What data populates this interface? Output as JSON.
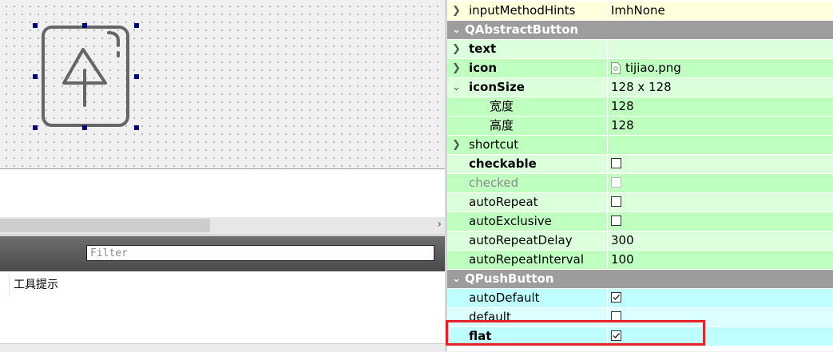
{
  "filter": {
    "placeholder": "Filter"
  },
  "action_list": {
    "items": [
      "工具提示"
    ]
  },
  "colors": {
    "highlight": "#e8202a",
    "category": "#9d9d9d",
    "green_light": "#dcffdc",
    "green_dark": "#bfffbf",
    "cyan_light": "#dcffff",
    "cyan_dark": "#bfffff",
    "yellow": "#ffffdc"
  },
  "properties": {
    "input_method_hints": {
      "name": "inputMethodHints",
      "value": "ImhNone"
    },
    "cat_abstract_button": "QAbstractButton",
    "text": {
      "name": "text",
      "value": ""
    },
    "icon": {
      "name": "icon",
      "value": "tijiao.png",
      "icon": "image-file-icon"
    },
    "icon_size": {
      "name": "iconSize",
      "value": "128 x 128"
    },
    "width": {
      "name": "宽度",
      "value": "128"
    },
    "height": {
      "name": "高度",
      "value": "128"
    },
    "shortcut": {
      "name": "shortcut",
      "value": ""
    },
    "checkable": {
      "name": "checkable",
      "checked": false
    },
    "checked": {
      "name": "checked",
      "checked": false
    },
    "auto_repeat": {
      "name": "autoRepeat",
      "checked": false
    },
    "auto_exclusive": {
      "name": "autoExclusive",
      "checked": false
    },
    "auto_repeat_delay": {
      "name": "autoRepeatDelay",
      "value": "300"
    },
    "auto_repeat_interval": {
      "name": "autoRepeatInterval",
      "value": "100"
    },
    "cat_push_button": "QPushButton",
    "auto_default": {
      "name": "autoDefault",
      "checked": true
    },
    "default": {
      "name": "default",
      "checked": false
    },
    "flat": {
      "name": "flat",
      "checked": true
    }
  }
}
